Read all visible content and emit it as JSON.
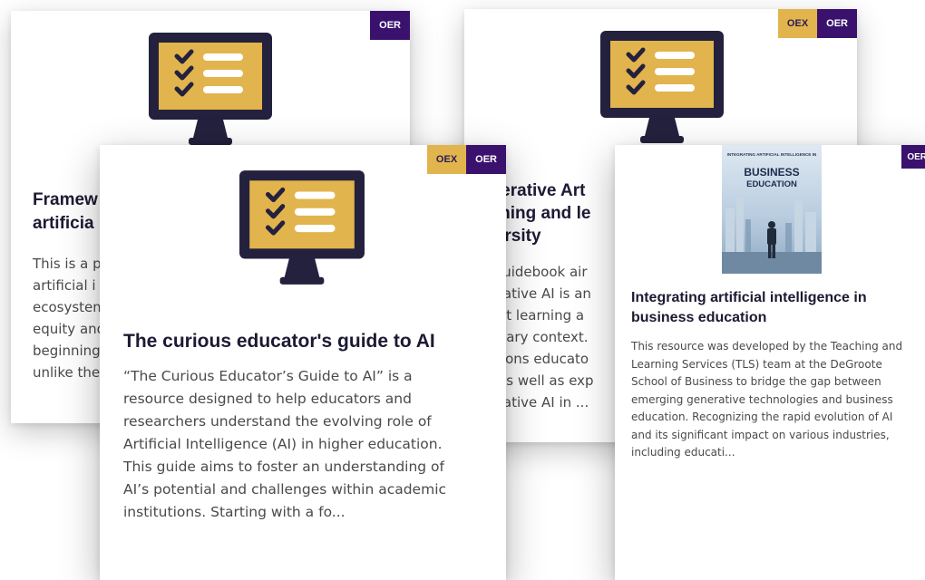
{
  "colors": {
    "oex_badge": "#e2b44d",
    "oer_badge": "#3a126e",
    "monitor_frame": "#23213d",
    "monitor_screen": "#e2b44d",
    "title_text": "#1c1a33",
    "body_text": "#4a4a4a"
  },
  "icons": {
    "checklist_monitor": "checklist-monitor-icon",
    "book_cover": "business-education-cover"
  },
  "cards": [
    {
      "badges": [
        "OER"
      ],
      "title": "Framew\nartificia",
      "description": "This is a p\nartificial i\necosystem\nequity and\nbeginning\nunlike the"
    },
    {
      "badges": [
        "OEX",
        "OER"
      ],
      "title": "enerative Art\naching and le\niversity",
      "description": "s Guidebook air\nnerative AI is an\ndent learning a\nondary context.\nestions educato\nh, as well as exp\nnerative AI in ..."
    },
    {
      "badges": [
        "OEX",
        "OER"
      ],
      "title": "The curious educator's guide to AI",
      "description": "“The Curious Educator’s Guide to AI” is a resource designed to help educators and researchers understand the evolving role of Artificial Intelligence (AI) in higher education. This guide aims to foster an understanding of AI’s potential and challenges within academic institutions. Starting with a fo..."
    },
    {
      "badges": [
        "OER"
      ],
      "cover_small_text": "INTEGRATING ARTIFICIAL INTELLIGENCE IN",
      "cover_big_text": "BUSINESS EDUCATION",
      "title": "Integrating artificial intelligence in business education",
      "description": "This resource was developed by the Teaching and Learning Services (TLS) team at the DeGroote School of Business to bridge the gap between emerging generative technologies and business education. Recognizing the rapid evolution of AI and its significant impact on various industries, including educati..."
    }
  ]
}
